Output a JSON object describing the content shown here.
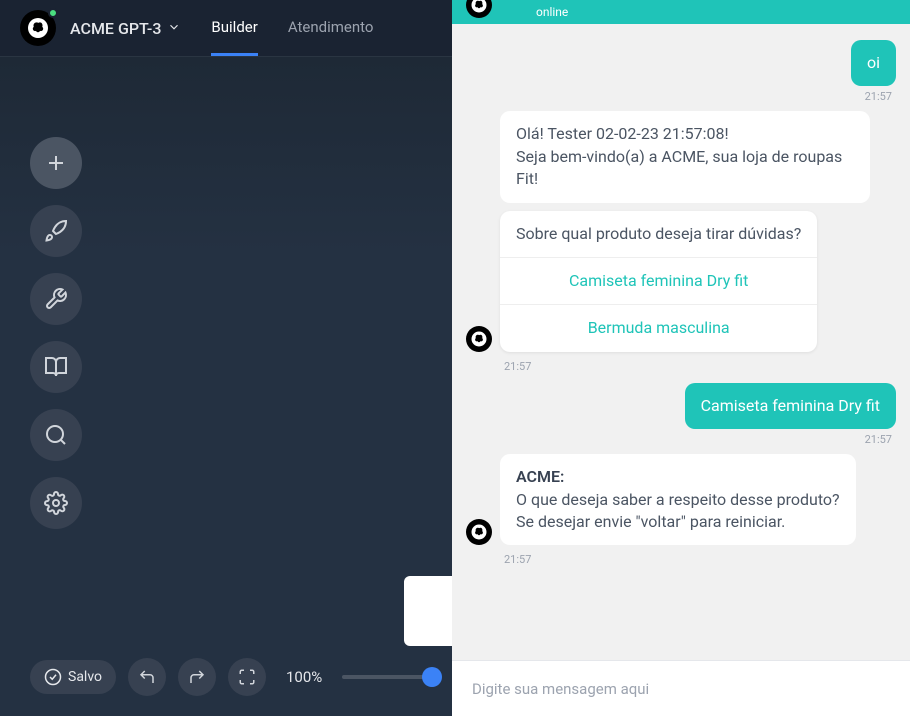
{
  "header": {
    "project_name": "ACME GPT-3",
    "tabs": [
      {
        "label": "Builder",
        "active": true
      },
      {
        "label": "Atendimento",
        "active": false
      }
    ]
  },
  "footer": {
    "save_label": "Salvo",
    "zoom_label": "100%"
  },
  "chat": {
    "status": "online",
    "input_placeholder": "Digite sua mensagem aqui",
    "messages": {
      "user1": "oi",
      "user1_time": "21:57",
      "bot1_line1": "Olá! Tester 02-02-23 21:57:08!",
      "bot1_line2": "Seja bem-vindo(a) a ACME, sua loja de roupas Fit!",
      "bot2_prompt": "Sobre qual produto deseja tirar dúvidas?",
      "bot2_option1": "Camiseta feminina Dry fit",
      "bot2_option2": "Bermuda masculina",
      "bot2_time": "21:57",
      "user2": "Camiseta feminina Dry fit",
      "user2_time": "21:57",
      "bot3_sender": "ACME:",
      "bot3_line1": "O que deseja saber a respeito desse produto?",
      "bot3_line2": "Se desejar envie \"voltar\" para reiniciar.",
      "bot3_time": "21:57"
    }
  }
}
